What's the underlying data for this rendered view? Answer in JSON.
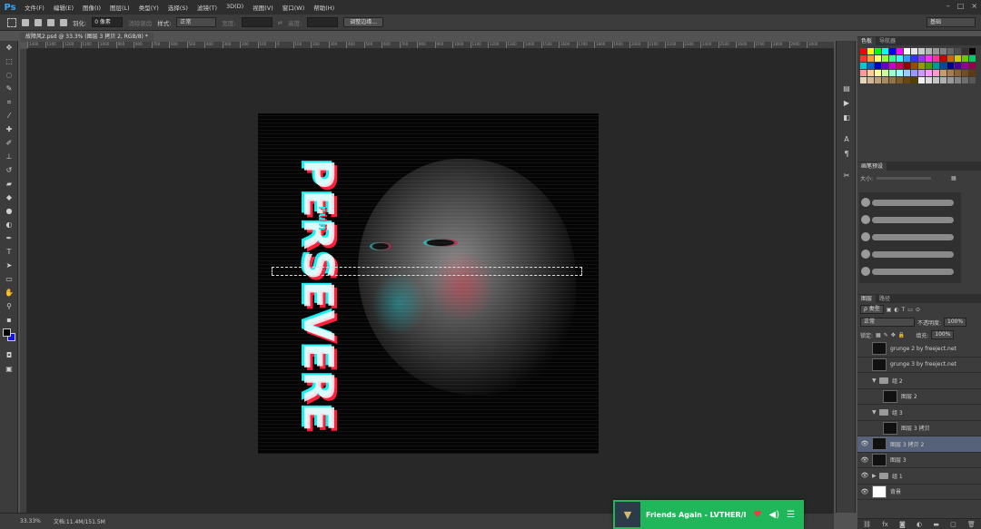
{
  "app": {
    "logo": "Ps"
  },
  "menu": [
    "文件(F)",
    "编辑(E)",
    "图像(I)",
    "图层(L)",
    "类型(Y)",
    "选择(S)",
    "滤镜(T)",
    "3D(D)",
    "视图(V)",
    "窗口(W)",
    "帮助(H)"
  ],
  "window_controls": [
    "–",
    "□",
    "×"
  ],
  "options": {
    "feather_label": "羽化:",
    "feather_value": "0 像素",
    "antialias_label": "消除锯齿",
    "style_label": "样式:",
    "style_value": "正常",
    "width_label": "宽度:",
    "height_label": "高度:",
    "refine_button": "调整边缘...",
    "workspace": "基础"
  },
  "document": {
    "tab": "故障风2.psd @ 33.3% (图层 3 拷贝 2, RGB/8) *",
    "title_text": "PERSEVERE",
    "subtitle_text": "run"
  },
  "ruler_ticks": [
    "1400",
    "1300",
    "1200",
    "1100",
    "1000",
    "900",
    "800",
    "700",
    "600",
    "500",
    "400",
    "300",
    "200",
    "100",
    "0",
    "100",
    "200",
    "300",
    "400",
    "500",
    "600",
    "700",
    "800",
    "900",
    "1000",
    "1100",
    "1200",
    "1300",
    "1400",
    "1500",
    "1600",
    "1700",
    "1800",
    "1900",
    "2000",
    "2100",
    "2200",
    "2300",
    "2400",
    "2500",
    "2600",
    "2700",
    "2800",
    "2900",
    "3000"
  ],
  "panels": {
    "swatches_tab": "色板",
    "navigator_tab": "导航器",
    "brush_tab": "画笔预设",
    "size_label": "大小:",
    "layers_tab": "图层",
    "paths_tab": "路径",
    "kind_label": "ρ 类型",
    "blend_mode": "正常",
    "opacity_label": "不透明度:",
    "opacity_value": "100%",
    "lock_label": "锁定:",
    "fill_label": "填充:",
    "fill_value": "100%"
  },
  "swatch_colors": [
    "#ff0000",
    "#ffff00",
    "#00ff00",
    "#00ffff",
    "#0000ff",
    "#ff00ff",
    "#ffffff",
    "#e6e6e6",
    "#cccccc",
    "#b3b3b3",
    "#999999",
    "#808080",
    "#666666",
    "#4d4d4d",
    "#333333",
    "#000000",
    "#ff3333",
    "#ff9933",
    "#ffff66",
    "#99ff33",
    "#33ff99",
    "#33ffff",
    "#3399ff",
    "#3333ff",
    "#9933ff",
    "#ff33ff",
    "#ff3399",
    "#cc0000",
    "#cc6600",
    "#cccc00",
    "#66cc00",
    "#00cc66",
    "#00cccc",
    "#0066cc",
    "#0000cc",
    "#6600cc",
    "#cc00cc",
    "#cc0066",
    "#990000",
    "#994c00",
    "#999900",
    "#4c9900",
    "#009999",
    "#004c99",
    "#000099",
    "#4c0099",
    "#990099",
    "#99004c",
    "#ff9999",
    "#ffcc99",
    "#ffff99",
    "#ccff99",
    "#99ffcc",
    "#99ffff",
    "#99ccff",
    "#9999ff",
    "#cc99ff",
    "#ff99ff",
    "#ff99cc",
    "#c69c6d",
    "#a67c52",
    "#8c6239",
    "#754c24",
    "#603813",
    "#e8d5b7",
    "#d4b896",
    "#bfa17a",
    "#aa8a5f",
    "#957345",
    "#805c2c",
    "#6b4613",
    "#564000",
    "#f2f2f2",
    "#dcdcdc",
    "#c6c6c6",
    "#b0b0b0",
    "#9a9a9a",
    "#848484",
    "#6e6e6e",
    "#585858"
  ],
  "layers": [
    {
      "name": "grunge 2 by freeject.net",
      "visible": false,
      "indent": 0,
      "type": "layer",
      "thumb": "dark"
    },
    {
      "name": "grunge 3 by freeject.net",
      "visible": false,
      "indent": 0,
      "type": "layer",
      "thumb": "dark"
    },
    {
      "name": "组 2",
      "visible": false,
      "indent": 0,
      "type": "group"
    },
    {
      "name": "图层 2",
      "visible": false,
      "indent": 1,
      "type": "layer",
      "thumb": "dark"
    },
    {
      "name": "组 3",
      "visible": false,
      "indent": 0,
      "type": "group"
    },
    {
      "name": "图层 3 拷贝",
      "visible": false,
      "indent": 1,
      "type": "layer",
      "thumb": "dark"
    },
    {
      "name": "图层 3 拷贝 2",
      "visible": true,
      "indent": 0,
      "type": "layer",
      "thumb": "dark",
      "selected": true
    },
    {
      "name": "图层 3",
      "visible": true,
      "indent": 0,
      "type": "layer",
      "thumb": "dark"
    },
    {
      "name": "组 1",
      "visible": true,
      "indent": 0,
      "type": "group",
      "collapsed": true
    },
    {
      "name": "背景",
      "visible": true,
      "indent": 0,
      "type": "layer",
      "thumb": "white"
    }
  ],
  "status": {
    "zoom": "33.33%",
    "doc_size": "文档:11.4M/151.5M"
  },
  "music": {
    "title": "Friends Again - LVTHER/I"
  }
}
